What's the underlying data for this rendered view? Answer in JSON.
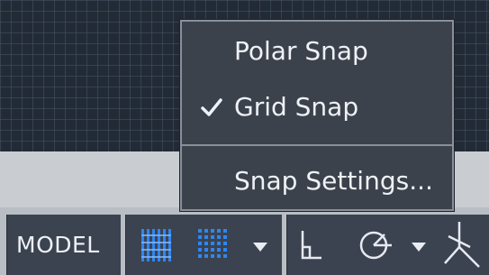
{
  "menu": {
    "items": [
      {
        "label": "Polar Snap",
        "checked": false
      },
      {
        "label": "Grid Snap",
        "checked": true
      },
      {
        "label": "Snap Settings...",
        "checked": false
      }
    ]
  },
  "statusbar": {
    "model_label": "MODEL",
    "icons": [
      "grid-display-icon",
      "snap-mode-icon",
      "dropdown-arrow-icon",
      "ortho-mode-icon",
      "polar-tracking-icon",
      "dropdown-arrow-icon",
      "isometric-drafting-icon"
    ]
  },
  "colors": {
    "canvas_background": "#222a36",
    "menu_background": "#3c424c",
    "menu_text": "#eef1f5",
    "accent_blue": "#2f86f0",
    "statusbar_cell": "#3b4350"
  }
}
